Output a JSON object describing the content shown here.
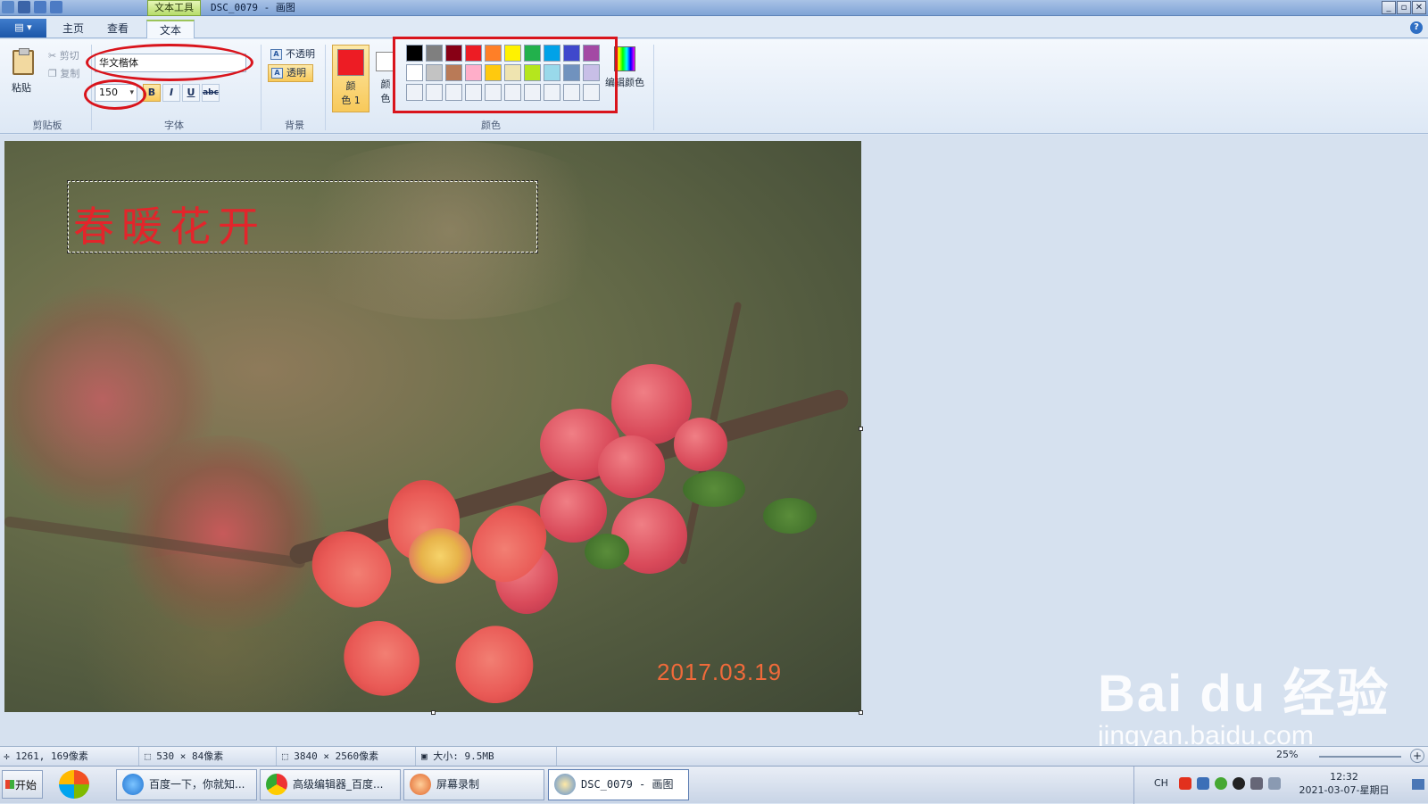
{
  "titlebar": {
    "context_tab": "文本工具",
    "title": "DSC_0079 - 画图",
    "buttons": [
      "_",
      "▫",
      "✕"
    ]
  },
  "tabs": [
    "主页",
    "查看",
    "文本"
  ],
  "app_menu_label": "▤ ▾",
  "ribbon": {
    "clipboard": {
      "paste": "粘贴",
      "cut": "剪切",
      "copy": "复制",
      "group": "剪贴板"
    },
    "font": {
      "family": "华文楷体",
      "size": "150",
      "bold": "B",
      "italic": "I",
      "underline": "U",
      "strike": "abc",
      "group": "字体"
    },
    "background": {
      "opaque": "不透明",
      "transparent": "透明",
      "group": "背景"
    },
    "colors": {
      "color1_label_1": "颜",
      "color1_label_2": "色 1",
      "color2_label_1": "颜",
      "color2_label_2": "色",
      "edit_colors": "编辑颜色",
      "group": "颜色",
      "palette": [
        "#000000",
        "#7f7f7f",
        "#880015",
        "#ed1c24",
        "#ff7f27",
        "#fff200",
        "#22b14c",
        "#00a2e8",
        "#3f48cc",
        "#a349a4",
        "#ffffff",
        "#c3c3c3",
        "#b97a57",
        "#ffaec9",
        "#ffc90e",
        "#efe4b0",
        "#b5e61d",
        "#99d9ea",
        "#7092be",
        "#c8bfe7",
        "#eef2f8",
        "#eef2f8",
        "#eef2f8",
        "#eef2f8",
        "#eef2f8",
        "#eef2f8",
        "#eef2f8",
        "#eef2f8",
        "#eef2f8",
        "#eef2f8"
      ],
      "primary": "#ed1c24",
      "secondary": "#ffffff"
    }
  },
  "canvas": {
    "overlay_text": "春暖花开",
    "date_stamp": "2017.03.19"
  },
  "statusbar": {
    "cursor": "1261, 169像素",
    "selection": "530 × 84像素",
    "image_size": "3840 × 2560像素",
    "file_size": "大小: 9.5MB",
    "zoom": "25%"
  },
  "taskbar": {
    "start": "开始",
    "items": [
      "百度一下，你就知...",
      "高级编辑器_百度...",
      "屏幕录制",
      "DSC_0079 - 画图"
    ],
    "lang": "CH",
    "time": "12:32",
    "date": "2021-03-07-星期日"
  },
  "watermark": {
    "big": "Bai du 经验",
    "small": "jingyan.baidu.com"
  }
}
